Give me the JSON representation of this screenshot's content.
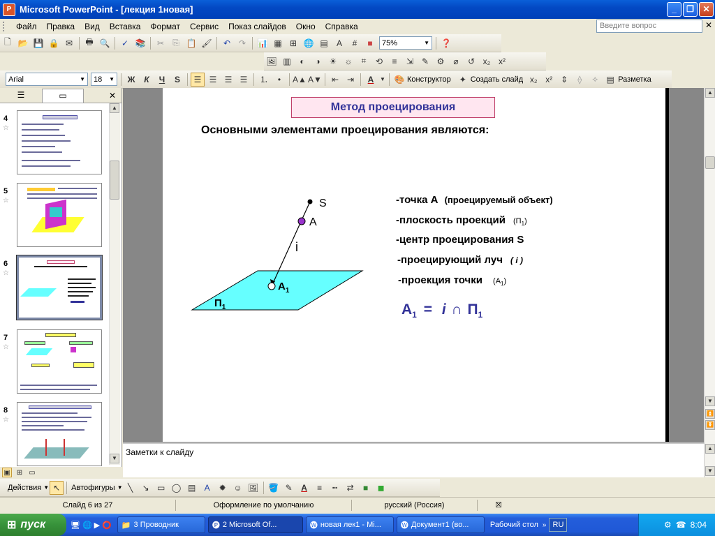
{
  "window": {
    "title": "Microsoft PowerPoint - [лекция 1новая]",
    "app_icon": "powerpoint-icon"
  },
  "menu": [
    "Файл",
    "Правка",
    "Вид",
    "Вставка",
    "Формат",
    "Сервис",
    "Показ слайдов",
    "Окно",
    "Справка"
  ],
  "help_placeholder": "Введите вопрос",
  "toolbar_std": {
    "zoom": "75%"
  },
  "toolbar_fmt": {
    "font": "Arial",
    "size": "18",
    "bold": "Ж",
    "italic": "К",
    "underline": "Ч",
    "shadow": "S",
    "designer": "Конструктор",
    "new_slide": "Создать слайд",
    "layout": "Разметка"
  },
  "panes": {
    "tab_outline": "outline-icon",
    "tab_slides": "slides-icon",
    "slides": [
      {
        "num": "4"
      },
      {
        "num": "5"
      },
      {
        "num": "6"
      },
      {
        "num": "7"
      },
      {
        "num": "8"
      }
    ]
  },
  "slide": {
    "title": "Метод проецирования",
    "subtitle": "Основными элементами проецирования являются:",
    "labels": {
      "S": "S",
      "A": "A",
      "i": "i",
      "A1_main": "A",
      "A1_sub": "1",
      "P1_main": "П",
      "P1_sub": "1"
    },
    "items": [
      {
        "main": "-точка А",
        "note": "(проецируемый объект)"
      },
      {
        "main": "-плоскость проекций",
        "note": "(П",
        "sub": "1",
        "close": ")"
      },
      {
        "main": "-центр проецирования  S",
        "note": ""
      },
      {
        "main": "-проецирующий луч",
        "note": "( i )"
      },
      {
        "main": "-проекция точки",
        "note": "(А",
        "sub": "1",
        "close": ")"
      }
    ],
    "formula": {
      "A": "А",
      "sub1": "1",
      "eq": "=",
      "i": "i",
      "cap": "∩",
      "P": "П",
      "sub2": "1"
    },
    "colors": {
      "title_bg": "#ffe6f0",
      "title_border": "#c0406a",
      "title_text": "#333399",
      "plane": "#66ffff",
      "formula": "#333399",
      "point_a": "#9933cc"
    }
  },
  "notes": "Заметки к слайду",
  "drawbar": {
    "actions": "Действия",
    "autoshapes": "Автофигуры"
  },
  "status": {
    "slide": "Слайд 6 из 27",
    "design": "Оформление по умолчанию",
    "lang": "русский (Россия)"
  },
  "taskbar": {
    "start": "пуск",
    "buttons": [
      {
        "label": "3 Проводник"
      },
      {
        "label": "2 Microsoft Of..."
      },
      {
        "label": "новая лек1 - Mi..."
      },
      {
        "label": "Документ1 (во..."
      },
      {
        "label": "Рабочий стол"
      }
    ],
    "lang": "RU",
    "clock": "8:04"
  }
}
